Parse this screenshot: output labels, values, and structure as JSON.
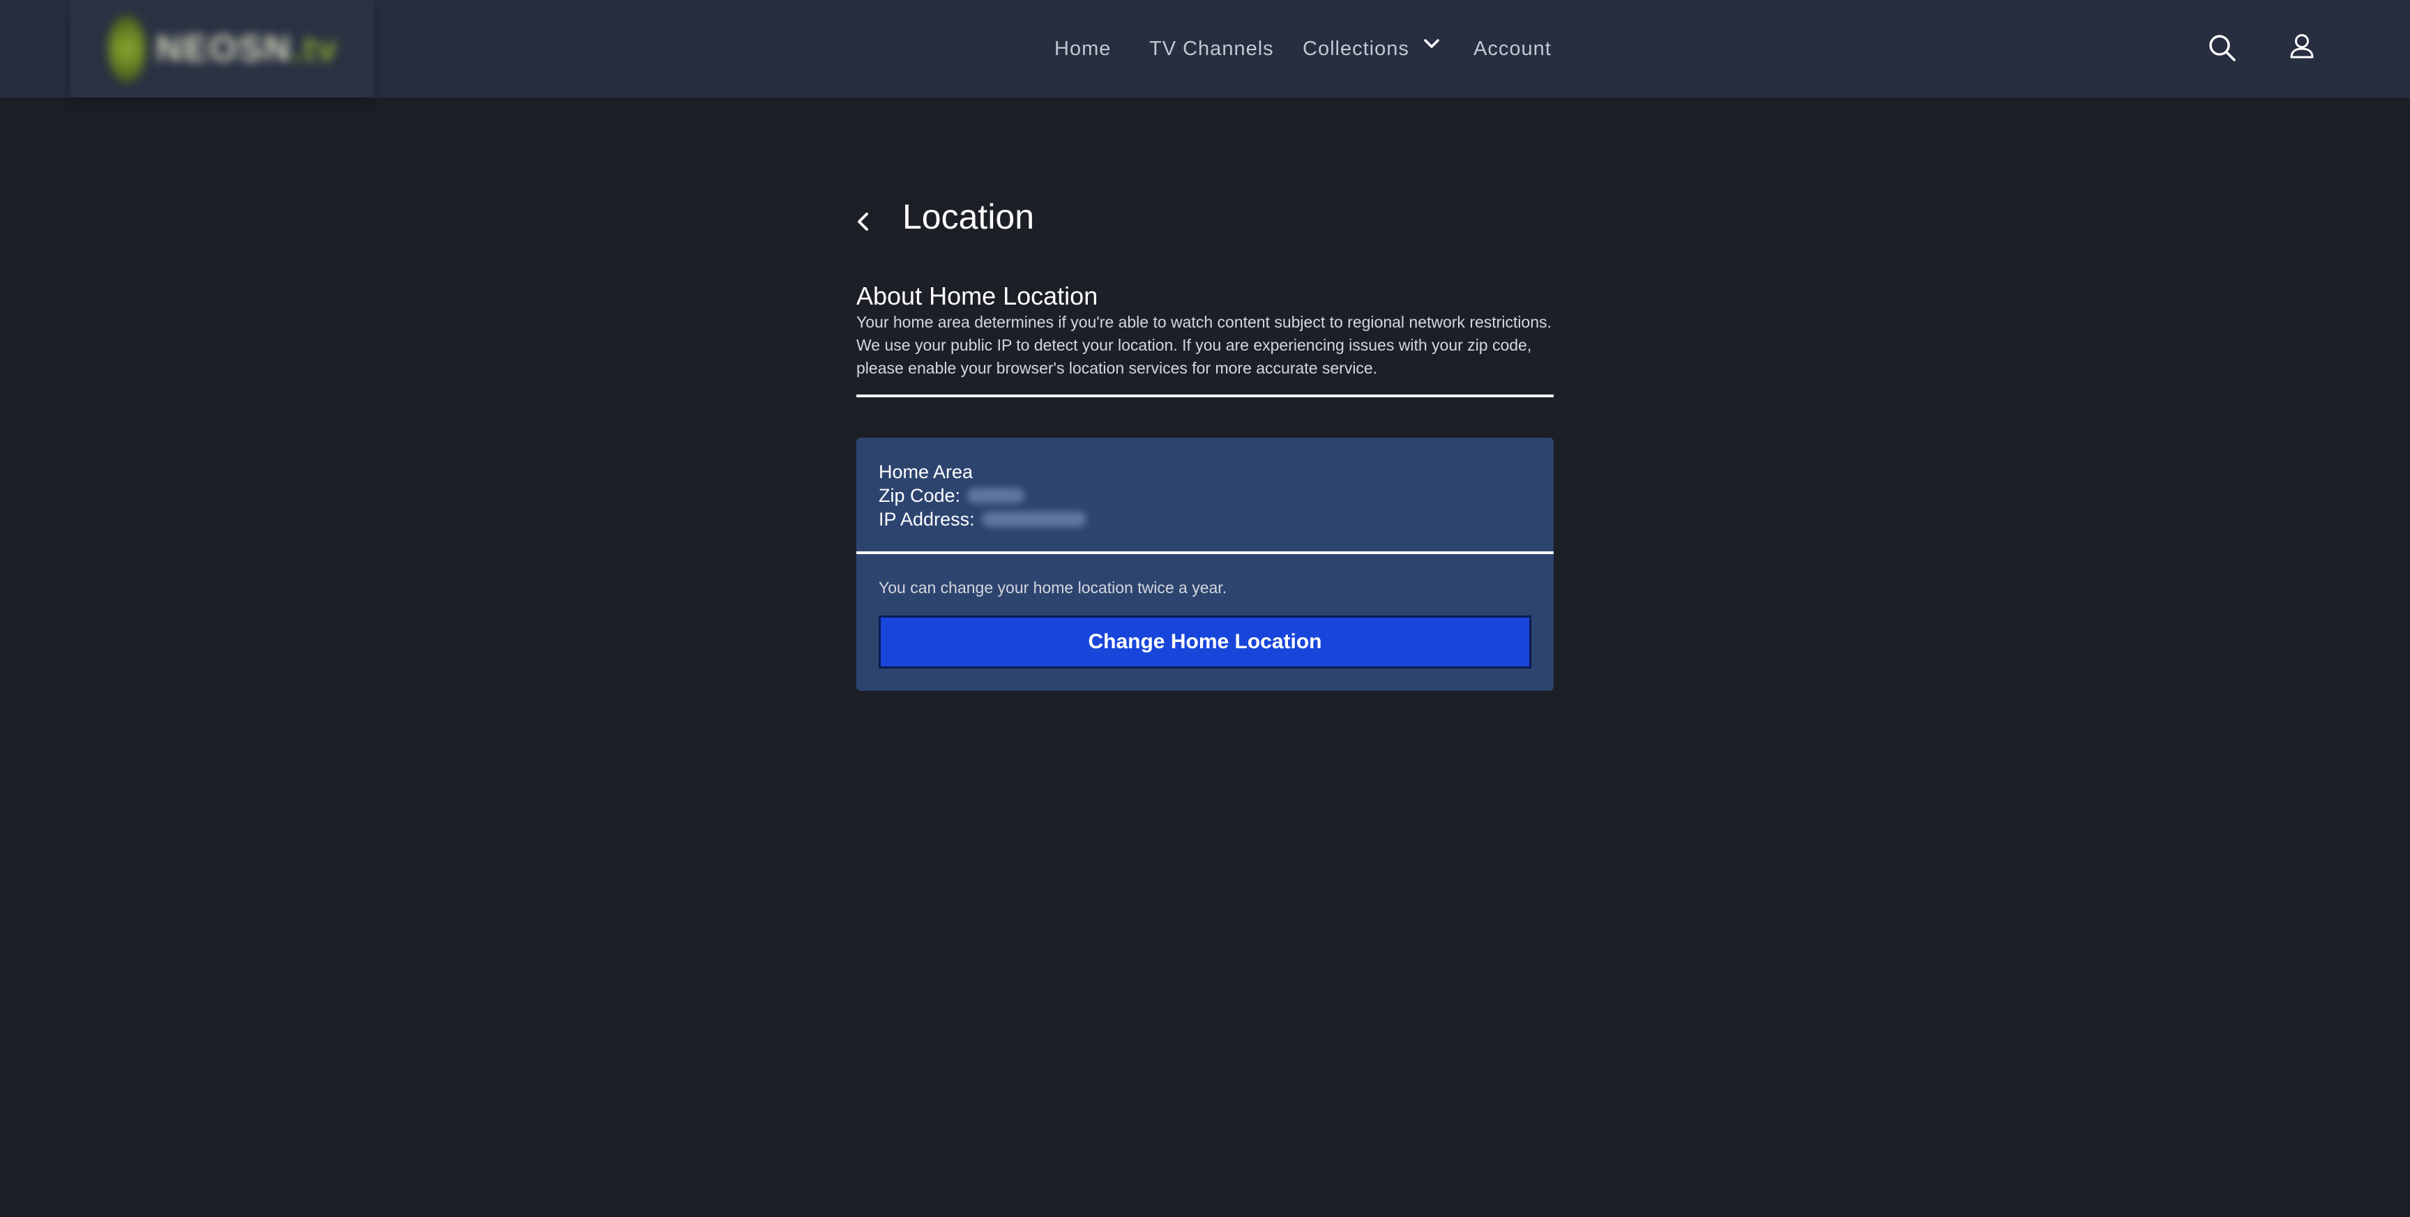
{
  "header": {
    "logo": {
      "text": "NEOSN",
      "tld": ".tv"
    },
    "nav": [
      {
        "label": "Home"
      },
      {
        "label": "TV Channels"
      },
      {
        "label": "Collections"
      },
      {
        "label": "Account"
      }
    ],
    "icons": [
      "search-icon",
      "user-icon",
      "chevron-down-icon"
    ]
  },
  "page": {
    "title": "Location"
  },
  "about": {
    "title": "About Home Location",
    "text": "Your home area determines if you're able to watch content subject to regional network restrictions. We use your public IP to detect your location. If you are experiencing issues with your zip code, please enable your browser's location services for more accurate service."
  },
  "card": {
    "heading": "Home Area",
    "zip_label": "Zip Code:",
    "ip_label": "IP Address:",
    "note": "You can change your home location twice a year.",
    "button_label": "Change Home Location"
  },
  "colors": {
    "background": "#1d1f27",
    "topbar": "#272e3f",
    "card": "#2d446f",
    "button": "#1846da"
  }
}
